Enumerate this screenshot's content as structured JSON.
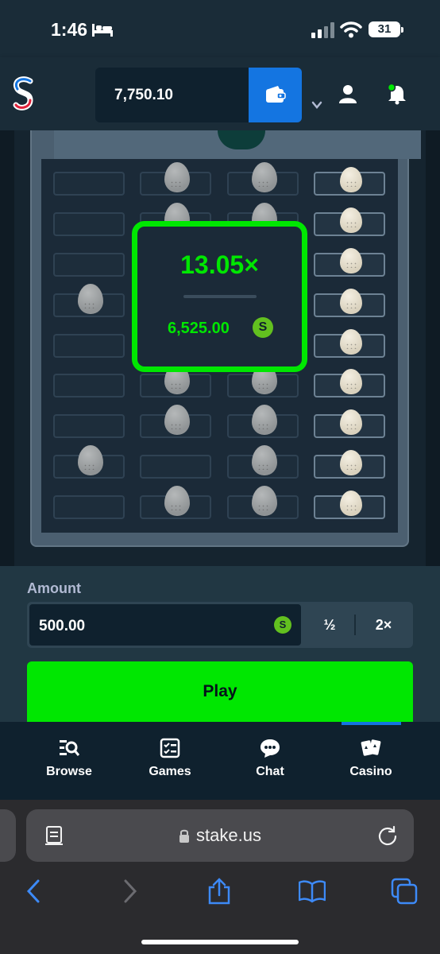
{
  "status_bar": {
    "time": "1:46",
    "battery": "31"
  },
  "header": {
    "balance": "7,750.10",
    "currency_symbol": "S",
    "icons": [
      "stake-logo-icon",
      "chevron-down-icon",
      "wallet-icon",
      "user-icon",
      "bell-icon"
    ]
  },
  "game": {
    "rows": [
      [
        "empty",
        "grey",
        "grey",
        "white"
      ],
      [
        "empty",
        "grey",
        "grey",
        "white"
      ],
      [
        "empty",
        "empty",
        "empty",
        "white"
      ],
      [
        "grey",
        "empty",
        "empty",
        "white"
      ],
      [
        "empty",
        "empty",
        "empty",
        "white"
      ],
      [
        "empty",
        "grey",
        "grey",
        "white"
      ],
      [
        "empty",
        "grey",
        "grey",
        "white"
      ],
      [
        "grey",
        "empty",
        "grey",
        "white"
      ],
      [
        "empty",
        "grey",
        "grey",
        "white"
      ]
    ],
    "win": {
      "multiplier": "13.05×",
      "payout": "6,525.00",
      "currency_symbol": "S"
    }
  },
  "bet": {
    "amount_label": "Amount",
    "amount_value": "500.00",
    "currency_symbol": "S",
    "half_label": "½",
    "double_label": "2×",
    "play_label": "Play"
  },
  "nav": {
    "items": [
      {
        "label": "Browse",
        "icon": "browse-icon"
      },
      {
        "label": "Games",
        "icon": "games-icon"
      },
      {
        "label": "Chat",
        "icon": "chat-icon"
      },
      {
        "label": "Casino",
        "icon": "casino-icon"
      }
    ]
  },
  "browser": {
    "url": "stake.us"
  },
  "colors": {
    "accent_green": "#00e701",
    "brand_blue": "#1475e1",
    "background": "#1a2c38"
  }
}
